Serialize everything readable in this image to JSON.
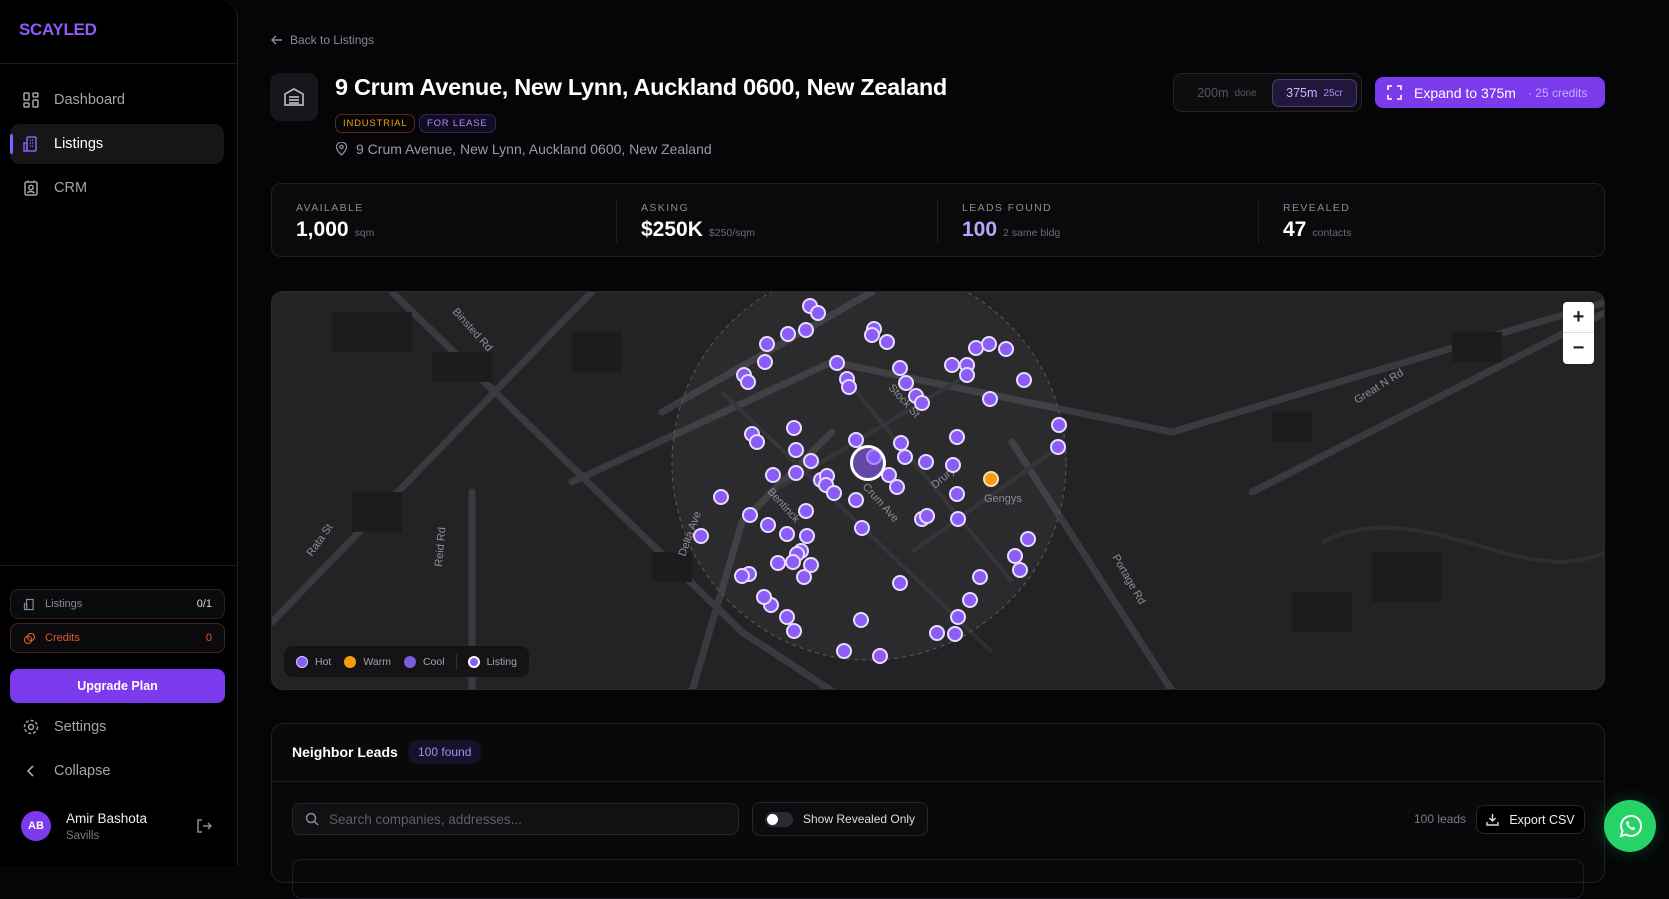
{
  "brand": "SCAYLED",
  "sidebar": {
    "items": [
      {
        "label": "Dashboard",
        "icon": "dashboard-icon"
      },
      {
        "label": "Listings",
        "icon": "building-icon",
        "active": true
      },
      {
        "label": "CRM",
        "icon": "contact-icon"
      }
    ],
    "usage": {
      "listings_label": "Listings",
      "listings_value": "0/1",
      "credits_label": "Credits",
      "credits_value": "0"
    },
    "upgrade": "Upgrade Plan",
    "settings": "Settings",
    "collapse": "Collapse",
    "user": {
      "initials": "AB",
      "name": "Amir Bashota",
      "org": "Savills"
    }
  },
  "header": {
    "back": "Back to Listings",
    "title": "9 Crum Avenue, New Lynn, Auckland 0600, New Zealand",
    "tags": [
      "INDUSTRIAL",
      "FOR LEASE"
    ],
    "address": "9 Crum Avenue, New Lynn, Auckland 0600, New Zealand",
    "range": [
      {
        "label": "200m",
        "sub": "done"
      },
      {
        "label": "375m",
        "sub": "25cr",
        "selected": true
      }
    ],
    "expand": {
      "label": "Expand to 375m",
      "sub": "· 25 credits"
    }
  },
  "stats": [
    {
      "label": "AVAILABLE",
      "value": "1,000",
      "unit": "sqm"
    },
    {
      "label": "ASKING",
      "value": "$250K",
      "unit": "$250/sqm"
    },
    {
      "label": "LEADS FOUND",
      "value": "100",
      "unit": "2 same bldg"
    },
    {
      "label": "REVEALED",
      "value": "47",
      "unit": "contacts"
    }
  ],
  "map": {
    "streets": [
      "Binsted Rd",
      "Great N Rd",
      "Stock St",
      "Crum Ave",
      "Drury",
      "Bentinck",
      "Delta Ave",
      "Reid Rd",
      "Rata St",
      "Portage Rd"
    ],
    "poi": "Gengys",
    "legend": [
      {
        "label": "Hot",
        "color": "#8b5cf6"
      },
      {
        "label": "Warm",
        "color": "#f59e0b"
      },
      {
        "label": "Cool",
        "color": "#7c5ce0"
      },
      {
        "label": "Listing",
        "color": "#8b5cf6"
      }
    ],
    "zoom_in": "+",
    "zoom_out": "−"
  },
  "leads": {
    "title": "Neighbor Leads",
    "badge": "100 found",
    "search_placeholder": "Search companies, addresses...",
    "toggle": "Show Revealed Only",
    "count": "100 leads",
    "export": "Export CSV"
  },
  "colors": {
    "accent": "#7c3aed",
    "marker": "#8b5cf6",
    "warm": "#f59e0b",
    "credits": "#e05a2b",
    "whatsapp": "#25d366"
  }
}
